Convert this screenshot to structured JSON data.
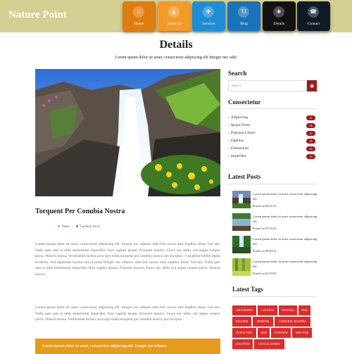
{
  "header": {
    "logo": "Nature Point",
    "nav": [
      {
        "label": "Home",
        "icon": "home-icon",
        "color": "#e08010"
      },
      {
        "label": "About Us",
        "icon": "landscape-icon",
        "color": "#f09a2a"
      },
      {
        "label": "Services",
        "icon": "ambulance-icon",
        "color": "#1f8bd1"
      },
      {
        "label": "Blog",
        "icon": "ti-icon",
        "color": "#1a70b8"
      },
      {
        "label": "Details",
        "icon": "leaf-icon",
        "color": "#111111"
      },
      {
        "label": "Contact",
        "icon": "phone-icon",
        "color": "#111c2b"
      }
    ]
  },
  "page": {
    "title": "Details",
    "subtitle": "Lorem ipsum dolor sit amet, consectetur adipiscing elit Integer nec odio"
  },
  "post": {
    "title": "Torquent Per Conubia Nostra",
    "author": "Posts",
    "category": "Lacinia, Arcu,",
    "paragraph1": "Lorem ipsum dolor sit amet, consectetur adipiscing elit. Integer nec odionec odio.Sed cursus ante dapibus diam. Sed nisi. Nulla quis sem at nibh elementum imperdiet. Duis sagittis ipsum. Praesent mauris. Fusce nec tellus sed augue semper porta. Mauris massa. Vestibulum lacinia arcu eget nulla.torquent per conubia nostra, per inceptos . Curabiturcubiles ligula in libero. Sed dignissim lacinia nunc.Lorem Integer nec odionec odio.Sed cursus ante dapibus diam. Sed nisi. Nulla quis sem at nibh elementum imperdiet. Duis sagittis ipsum. Praesent mauris. Fusce nec tellus sed augue semper porta. Mauris massa.",
    "paragraph2": "Lorem ipsum dolor sit amet, consectetur adipiscing elit. Integer nec odionec odio.Sed cursus ante dapibus diam. Sed nisi. Nulla quis sem at nibh elementum imperdiet. Duis sagittis ipsum. Praesent mauris. Fusce nec tellus sed augue semper porta. Mauris massa. Vestibulum lacinia arcu eget nulla.torquent per conubia nostra, per inceptos .",
    "quote": "Lorem ipsum dolor sit amet, consectetur adipiscing elit. Integer nec odionec"
  },
  "sidebar": {
    "search_title": "Search",
    "search_placeholder": "Search",
    "categories_title": "Consectetur",
    "categories": [
      {
        "label": "Adipiscing",
        "count": "11"
      },
      {
        "label": "Ipsum Dolor",
        "count": "14"
      },
      {
        "label": "Praesent Libero",
        "count": "13"
      },
      {
        "label": "Dapibus",
        "count": "18"
      },
      {
        "label": "Elementum",
        "count": "16"
      },
      {
        "label": "Imperdiet",
        "count": "15"
      }
    ],
    "recent_title": "Latest Posts",
    "recent": [
      {
        "text": "Lorem ipsum dolor sit amet consectetur adipiscing elit",
        "date": "Posted on 06/22/14"
      },
      {
        "text": "Lorem ipsum dolor sit amet consectetur adipiscing elit",
        "date": "Posted on 07/25/14"
      },
      {
        "text": "Lorem ipsum dolor sit amet consectetur adipiscing elit",
        "date": "Posted on 08/20/14"
      },
      {
        "text": "Lorem ipsum dolor sit amet consectetur adipiscing elit",
        "date": "Posted on 01/15/16"
      }
    ],
    "tags_title": "Latest Tags",
    "tags": [
      "DIGNISSIM",
      "LACINIA",
      "NOSTRA",
      "PER",
      "MAURIS",
      "SEMPER",
      "CONUBIA NOSTRA",
      "FUSCE NEC",
      "SED",
      "INTEGER",
      "SED NISI",
      "SAGITTIS",
      "AUGUE SEMPE"
    ]
  }
}
